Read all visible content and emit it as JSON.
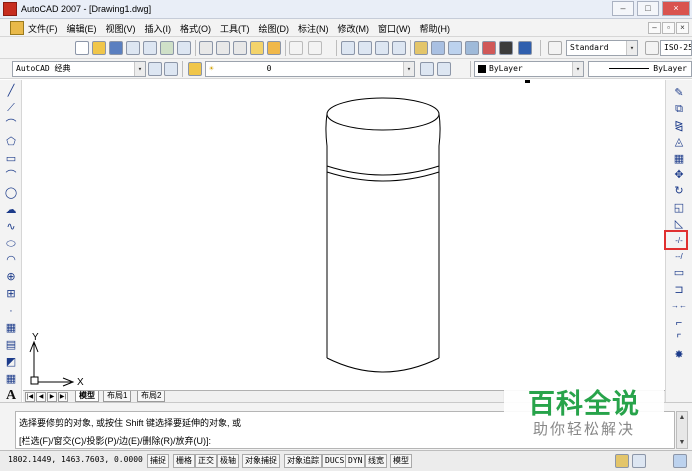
{
  "window": {
    "title": "AutoCAD 2007 - [Drawing1.dwg]",
    "controls": {
      "minimize": "–",
      "maximize": "□",
      "close": "×"
    }
  },
  "menubar": {
    "items": [
      "文件(F)",
      "编辑(E)",
      "视图(V)",
      "插入(I)",
      "格式(O)",
      "工具(T)",
      "绘图(D)",
      "标注(N)",
      "修改(M)",
      "窗口(W)",
      "帮助(H)"
    ],
    "doc_controls": {
      "minimize": "–",
      "restore": "▫",
      "close": "×"
    }
  },
  "toolbars": {
    "text_style": {
      "value": "Standard"
    },
    "dim_style": {
      "value": "ISO-25"
    },
    "workspace": {
      "value": "AutoCAD 经典"
    },
    "layer": {
      "value": "0"
    },
    "layer_prefix": "☀",
    "color": {
      "value": "ByLayer"
    },
    "linetype": {
      "value": "ByLayer"
    },
    "combo_arrow": "▾"
  },
  "draw_tools": [
    {
      "name": "line-tool-icon",
      "glyph": "╱"
    },
    {
      "name": "construction-line-icon",
      "glyph": "⟋"
    },
    {
      "name": "polyline-icon",
      "glyph": "⌒"
    },
    {
      "name": "polygon-icon",
      "glyph": "⬠"
    },
    {
      "name": "rectangle-icon",
      "glyph": "▭"
    },
    {
      "name": "arc-icon",
      "glyph": "⌒"
    },
    {
      "name": "circle-icon",
      "glyph": "◯"
    },
    {
      "name": "revision-cloud-icon",
      "glyph": "☁"
    },
    {
      "name": "spline-icon",
      "glyph": "∿"
    },
    {
      "name": "ellipse-icon",
      "glyph": "⬭"
    },
    {
      "name": "ellipse-arc-icon",
      "glyph": "◠"
    },
    {
      "name": "insert-block-icon",
      "glyph": "⊕"
    },
    {
      "name": "make-block-icon",
      "glyph": "⊞"
    },
    {
      "name": "point-icon",
      "glyph": "·"
    },
    {
      "name": "hatch-icon",
      "glyph": "▦"
    },
    {
      "name": "gradient-icon",
      "glyph": "▤"
    },
    {
      "name": "region-icon",
      "glyph": "◩"
    },
    {
      "name": "table-icon",
      "glyph": "▦"
    },
    {
      "name": "multiline-text-icon",
      "glyph": "A"
    }
  ],
  "modify_tools": [
    {
      "name": "erase-icon",
      "glyph": "✎"
    },
    {
      "name": "copy-icon",
      "glyph": "⧉"
    },
    {
      "name": "mirror-icon",
      "glyph": "⧎"
    },
    {
      "name": "offset-icon",
      "glyph": "◬"
    },
    {
      "name": "array-icon",
      "glyph": "▦"
    },
    {
      "name": "move-icon",
      "glyph": "✥"
    },
    {
      "name": "rotate-icon",
      "glyph": "↻"
    },
    {
      "name": "scale-icon",
      "glyph": "◱"
    },
    {
      "name": "stretch-icon",
      "glyph": "◺"
    },
    {
      "name": "trim-icon",
      "glyph": "-/-"
    },
    {
      "name": "extend-icon",
      "glyph": "--/"
    },
    {
      "name": "break-at-point-icon",
      "glyph": "▭"
    },
    {
      "name": "break-icon",
      "glyph": "⊐"
    },
    {
      "name": "join-icon",
      "glyph": "→←"
    },
    {
      "name": "chamfer-icon",
      "glyph": "⌐"
    },
    {
      "name": "fillet-icon",
      "glyph": "⌜"
    },
    {
      "name": "explode-icon",
      "glyph": "✸"
    }
  ],
  "canvas": {
    "ucs_x": "X",
    "ucs_y": "Y"
  },
  "layout_tabs": {
    "nav": [
      "|◀",
      "◀",
      "▶",
      "▶|"
    ],
    "tabs": [
      "模型",
      "布局1",
      "布局2"
    ]
  },
  "command": {
    "line1": "选择要修剪的对象, 或按住 Shift 键选择要延伸的对象, 或",
    "line2": "[栏选(F)/窗交(C)/投影(P)/边(E)/删除(R)/放弃(U)]:",
    "scroll_up": "▲",
    "scroll_down": "▼"
  },
  "status": {
    "coords": "1802.1449, 1463.7603, 0.0000",
    "buttons": [
      "捕捉",
      "栅格",
      "正交",
      "极轴",
      "对象捕捉",
      "对象追踪",
      "DUCS",
      "DYN",
      "线宽",
      "模型"
    ]
  },
  "watermark": {
    "main": "百科全说",
    "sub": "助你轻松解决"
  }
}
